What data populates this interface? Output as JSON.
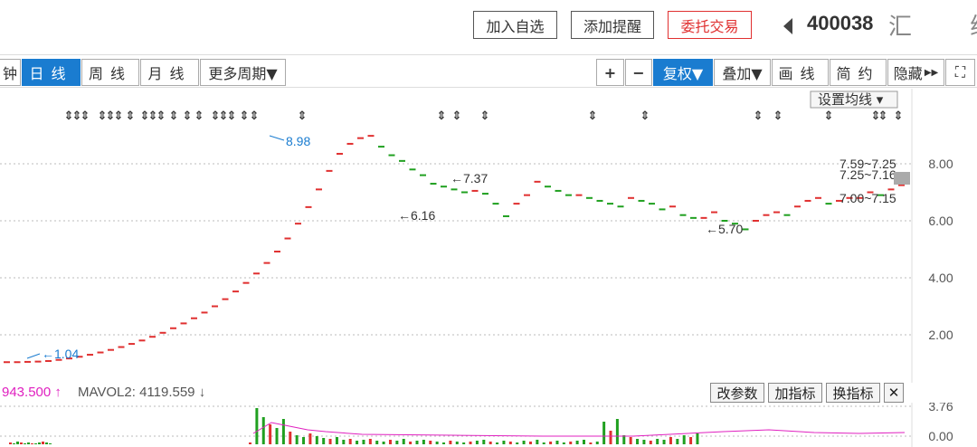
{
  "top_actions": {
    "add_watch": "加入自选",
    "add_alert": "添加提醒",
    "trade": "委托交易",
    "stock_code": "400038",
    "stock_name": "汇 绿"
  },
  "toolbar": {
    "minute": "钟",
    "daily": "日线",
    "weekly": "周线",
    "monthly": "月线",
    "more_periods": "更多周期▼",
    "plus": "+",
    "minus": "−",
    "restore_rights": "复权▼",
    "overlay": "叠加▼",
    "draw_line": "画线",
    "simple": "简约",
    "hide": "隐藏",
    "fullscreen": "⛶"
  },
  "chart": {
    "ma_settings": "设置均线 ▾",
    "y_ticks": [
      "8.00",
      "6.00",
      "4.00",
      "2.00"
    ],
    "annotations": {
      "high": "8.98",
      "low_start": "1.04",
      "low_mid": "6.16",
      "high_mid": "7.37",
      "low_late": "5.70",
      "range1": "7.59~7.25",
      "range2": "7.25~7.16",
      "range3": "7.00~7.15"
    }
  },
  "volume": {
    "val1": "943.500 ↑",
    "val2": "MAVOL2: 4119.559 ↓",
    "btn_params": "改参数",
    "btn_add": "加指标",
    "btn_switch": "换指标",
    "btn_close": "✕",
    "y_ticks": [
      "3.76",
      "0.00"
    ]
  },
  "chart_data": {
    "type": "line",
    "title": "",
    "ylim": [
      0.5,
      10
    ],
    "price_series_name": "",
    "points": [
      [
        0,
        1.04
      ],
      [
        1,
        1.04
      ],
      [
        2,
        1.05
      ],
      [
        3,
        1.06
      ],
      [
        4,
        1.08
      ],
      [
        5,
        1.12
      ],
      [
        6,
        1.17
      ],
      [
        7,
        1.23
      ],
      [
        8,
        1.3
      ],
      [
        9,
        1.38
      ],
      [
        10,
        1.47
      ],
      [
        11,
        1.57
      ],
      [
        12,
        1.68
      ],
      [
        13,
        1.8
      ],
      [
        14,
        1.93
      ],
      [
        15,
        2.07
      ],
      [
        16,
        2.23
      ],
      [
        17,
        2.4
      ],
      [
        18,
        2.58
      ],
      [
        19,
        2.78
      ],
      [
        20,
        3.0
      ],
      [
        21,
        3.25
      ],
      [
        22,
        3.52
      ],
      [
        23,
        3.82
      ],
      [
        24,
        4.15
      ],
      [
        25,
        4.52
      ],
      [
        26,
        4.92
      ],
      [
        27,
        5.38
      ],
      [
        28,
        5.9
      ],
      [
        29,
        6.48
      ],
      [
        30,
        7.1
      ],
      [
        31,
        7.75
      ],
      [
        32,
        8.35
      ],
      [
        33,
        8.7
      ],
      [
        34,
        8.9
      ],
      [
        35,
        8.98
      ],
      [
        36,
        8.6
      ],
      [
        37,
        8.3
      ],
      [
        38,
        8.1
      ],
      [
        39,
        7.8
      ],
      [
        40,
        7.6
      ],
      [
        41,
        7.3
      ],
      [
        42,
        7.2
      ],
      [
        43,
        7.1
      ],
      [
        44,
        7.0
      ],
      [
        45,
        7.05
      ],
      [
        46,
        6.95
      ],
      [
        47,
        6.6
      ],
      [
        48,
        6.16
      ],
      [
        49,
        6.6
      ],
      [
        50,
        6.9
      ],
      [
        51,
        7.37
      ],
      [
        52,
        7.2
      ],
      [
        53,
        7.05
      ],
      [
        54,
        6.9
      ],
      [
        55,
        6.9
      ],
      [
        56,
        6.8
      ],
      [
        57,
        6.7
      ],
      [
        58,
        6.6
      ],
      [
        59,
        6.5
      ],
      [
        60,
        6.8
      ],
      [
        61,
        6.7
      ],
      [
        62,
        6.6
      ],
      [
        63,
        6.4
      ],
      [
        64,
        6.5
      ],
      [
        65,
        6.2
      ],
      [
        66,
        6.1
      ],
      [
        67,
        6.1
      ],
      [
        68,
        6.3
      ],
      [
        69,
        6.0
      ],
      [
        70,
        5.9
      ],
      [
        71,
        5.7
      ],
      [
        72,
        6.0
      ],
      [
        73,
        6.2
      ],
      [
        74,
        6.3
      ],
      [
        75,
        6.2
      ],
      [
        76,
        6.5
      ],
      [
        77,
        6.7
      ],
      [
        78,
        6.8
      ],
      [
        79,
        6.6
      ],
      [
        80,
        6.7
      ],
      [
        81,
        6.8
      ],
      [
        82,
        6.8
      ],
      [
        83,
        7.0
      ],
      [
        84,
        6.9
      ],
      [
        85,
        7.1
      ],
      [
        86,
        7.25
      ]
    ]
  }
}
